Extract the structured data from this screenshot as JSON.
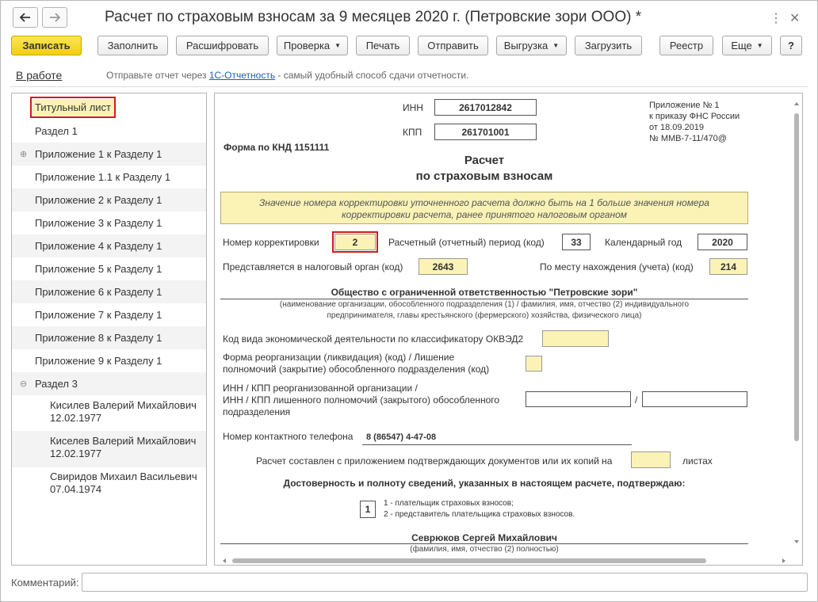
{
  "window": {
    "title": "Расчет по страховым взносам за 9 месяцев 2020 г. (Петровские зори ООО) *"
  },
  "toolbar": {
    "save": "Записать",
    "fill": "Заполнить",
    "decode": "Расшифровать",
    "check": "Проверка",
    "print": "Печать",
    "send": "Отправить",
    "export": "Выгрузка",
    "import": "Загрузить",
    "registry": "Реестр",
    "more": "Еще",
    "help": "?"
  },
  "status": {
    "state": "В работе",
    "message_before": "Отправьте отчет через ",
    "link": "1С-Отчетность",
    "message_after": " - самый удобный способ сдачи отчетности."
  },
  "sections": [
    {
      "label": "Титульный лист"
    },
    {
      "label": "Раздел 1"
    },
    {
      "label": "Приложение 1 к Разделу 1"
    },
    {
      "label": "Приложение 1.1 к Разделу 1"
    },
    {
      "label": "Приложение 2 к Разделу 1"
    },
    {
      "label": "Приложение 3 к Разделу 1"
    },
    {
      "label": "Приложение 4 к Разделу 1"
    },
    {
      "label": "Приложение 5 к Разделу 1"
    },
    {
      "label": "Приложение 6 к Разделу 1"
    },
    {
      "label": "Приложение 7 к Разделу 1"
    },
    {
      "label": "Приложение 8 к Разделу 1"
    },
    {
      "label": "Приложение 9 к Разделу 1"
    },
    {
      "label": "Раздел 3"
    }
  ],
  "employees": [
    {
      "name": "Кисилев Валерий Михайлович",
      "date": "12.02.1977"
    },
    {
      "name": "Киселев Валерий Михайлович",
      "date": "12.02.1977"
    },
    {
      "name": "Свиридов Михаил Васильевич",
      "date": "07.04.1974"
    }
  ],
  "form": {
    "inn_label": "ИНН",
    "inn": "2617012842",
    "kpp_label": "КПП",
    "kpp": "261701001",
    "knd": "Форма по КНД 1151111",
    "appendix": [
      "Приложение № 1",
      "к приказу ФНС России",
      "от 18.09.2019",
      "№ ММВ-7-11/470@"
    ],
    "title1": "Расчет",
    "title2": "по страховым взносам",
    "notice1": "Значение номера корректировки уточненного расчета должно быть на 1 больше значения номера",
    "notice2": "корректировки расчета, ранее принятого налоговым органом",
    "corr_label": "Номер корректировки",
    "corr": "2",
    "period_label": "Расчетный (отчетный) период (код)",
    "period": "33",
    "year_label": "Календарный год",
    "year": "2020",
    "tax_label": "Представляется в налоговый орган (код)",
    "tax": "2643",
    "place_label": "По месту нахождения (учета) (код)",
    "place": "214",
    "org_name": "Общество с ограниченной ответственностью \"Петровские зори\"",
    "org_hint1": "(наименование организации, обособленного подразделения (1) / фамилия, имя, отчество (2) индивидуального",
    "org_hint2": "предпринимателя, главы крестьянского (фермерского) хозяйства, физического лица)",
    "okved_label": "Код вида экономической деятельности по классификатору ОКВЭД2",
    "reorg_label1": "Форма реорганизации (ликвидация) (код) / Лишение",
    "reorg_label2": "полномочий (закрытие) обособленного подразделения (код)",
    "innkpp_label1": "ИНН / КПП реорганизованной организации /",
    "innkpp_label2": "ИНН / КПП лишенного полномочий (закрытого) обособленного",
    "innkpp_label3": "подразделения",
    "slash": "/",
    "phone_label": "Номер контактного телефона",
    "phone": "8 (86547) 4-47-08",
    "pages_label": "Расчет составлен с приложением подтверждающих документов или их копий на",
    "pages_suffix": "листах",
    "confirm": "Достоверность и полноту сведений, указанных в настоящем расчете, подтверждаю:",
    "signer_code": "1",
    "signer_opt1": "1 - плательщик страховых взносов;",
    "signer_opt2": "2 - представитель плательщика страховых взносов.",
    "signer_name": "Севрюков Сергей Михайлович",
    "signer_hint": "(фамилия, имя, отчество (2) полностью)"
  },
  "comment": {
    "label": "Комментарий:",
    "value": ""
  },
  "colors": {
    "accent": "#f3cf0a",
    "field_yellow": "#fbf3b6",
    "highlight_red": "#d21a1a",
    "link": "#1a5fb4"
  }
}
